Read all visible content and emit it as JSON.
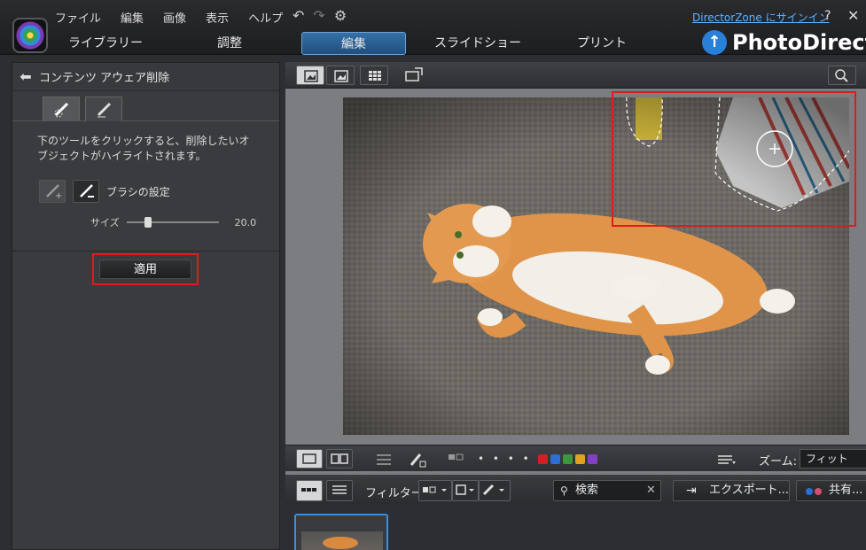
{
  "menu": {
    "items": [
      "ファイル",
      "編集",
      "画像",
      "表示",
      "ヘルプ"
    ],
    "directorzone_link": "DirectorZone にサインイン",
    "help": "?",
    "close": "✕"
  },
  "tabs": [
    "ライブラリー",
    "調整",
    "編集",
    "スライドショー",
    "プリント"
  ],
  "active_tab": "編集",
  "brand": {
    "name": "PhotoDirect",
    "brand_color": "#2a7fd8"
  },
  "left_panel": {
    "title": "コンテンツ アウェア削除",
    "description": "下のツールをクリックすると、削除したいオブジェクトがハイライトされます。",
    "brush_label": "ブラシの設定",
    "size_label": "サイズ",
    "size_value": "20.0",
    "size_fraction": 0.2,
    "apply_label": "適用"
  },
  "bottom_toolbar": {
    "dots": "• • • • •",
    "color_labels": [
      "#d02020",
      "#2a6fd6",
      "#3a9a3a",
      "#e0a020",
      "#8040c0"
    ],
    "zoom_label": "ズーム:",
    "zoom_value": "フィット"
  },
  "filmstrip_bar": {
    "filter_label": "フィルター:",
    "search_value": "検索",
    "export_label": "エクスポート...",
    "share_label": "共有..."
  },
  "colors": {
    "accent": "#3a8fe0",
    "highlight_red": "#e01b1b"
  }
}
